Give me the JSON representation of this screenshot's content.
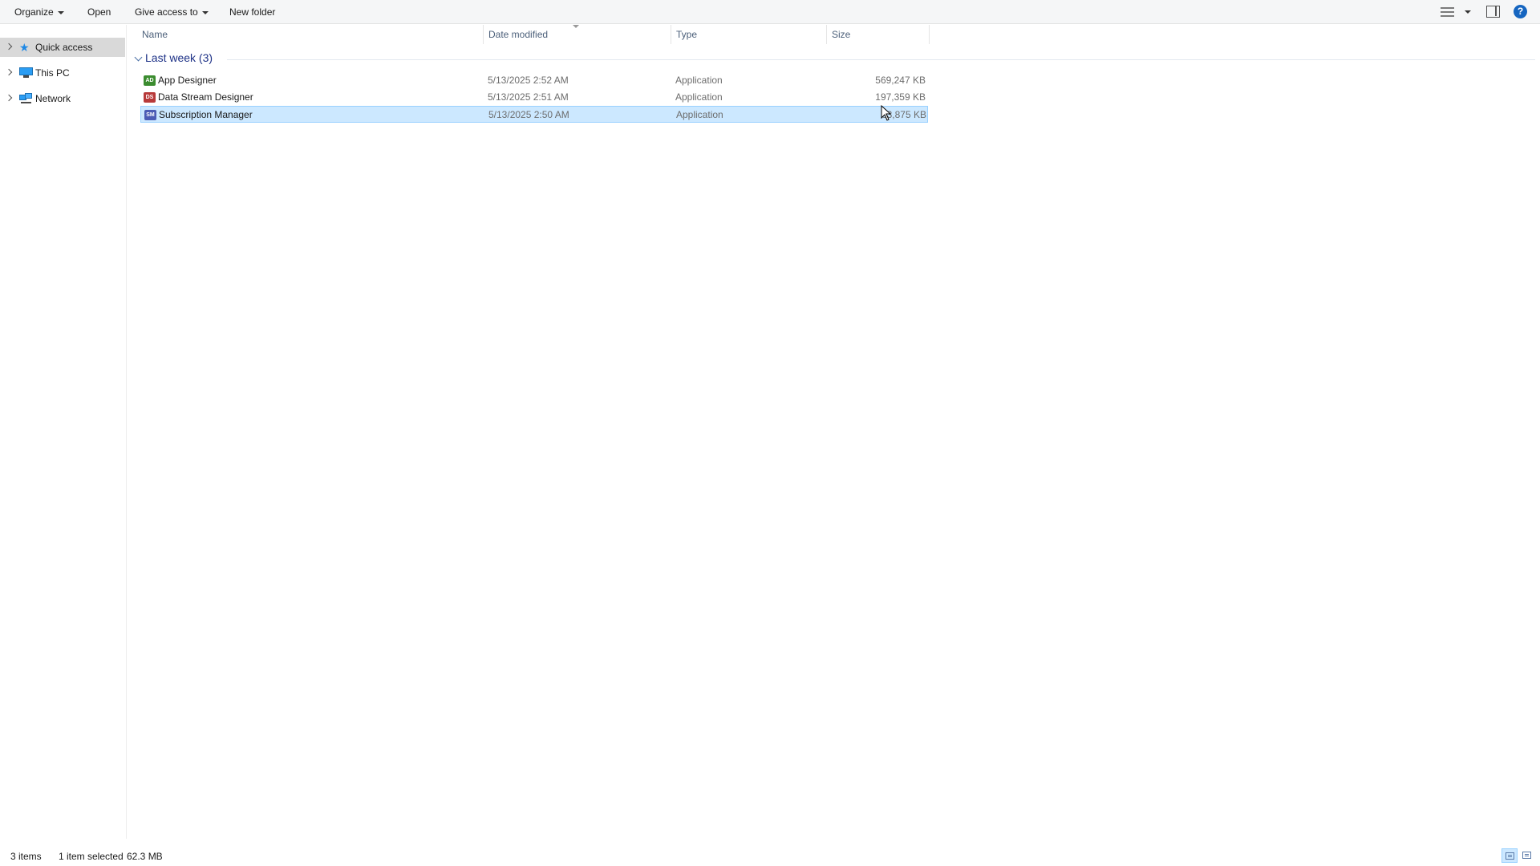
{
  "toolbar": {
    "organize": "Organize",
    "open": "Open",
    "give_access": "Give access to",
    "new_folder": "New folder",
    "help": "?"
  },
  "nav": {
    "items": [
      {
        "label": "Quick access",
        "icon": "star-icon",
        "selected": true
      },
      {
        "label": "This PC",
        "icon": "computer-icon",
        "selected": false
      },
      {
        "label": "Network",
        "icon": "network-icon",
        "selected": false
      }
    ]
  },
  "columns": {
    "name": "Name",
    "date": "Date modified",
    "type": "Type",
    "size": "Size"
  },
  "group": {
    "label": "Last week (3)"
  },
  "files": [
    {
      "icon_text": "AD",
      "icon_color": "#3b8c2f",
      "name": "App Designer",
      "date": "5/13/2025 2:52 AM",
      "type": "Application",
      "size": "569,247 KB",
      "selected": false
    },
    {
      "icon_text": "DS",
      "icon_color": "#b83a3a",
      "name": "Data Stream Designer",
      "date": "5/13/2025 2:51 AM",
      "type": "Application",
      "size": "197,359 KB",
      "selected": false
    },
    {
      "icon_text": "SM",
      "icon_color": "#4b5bb5",
      "name": "Subscription Manager",
      "date": "5/13/2025 2:50 AM",
      "type": "Application",
      "size": "63,875 KB",
      "selected": true
    }
  ],
  "status": {
    "count": "3 items",
    "selection": "1 item selected",
    "size": "62.3 MB"
  },
  "colors": {
    "selection_bg": "#cce8ff",
    "selection_border": "#99d1ff",
    "group_text": "#1e3287"
  }
}
